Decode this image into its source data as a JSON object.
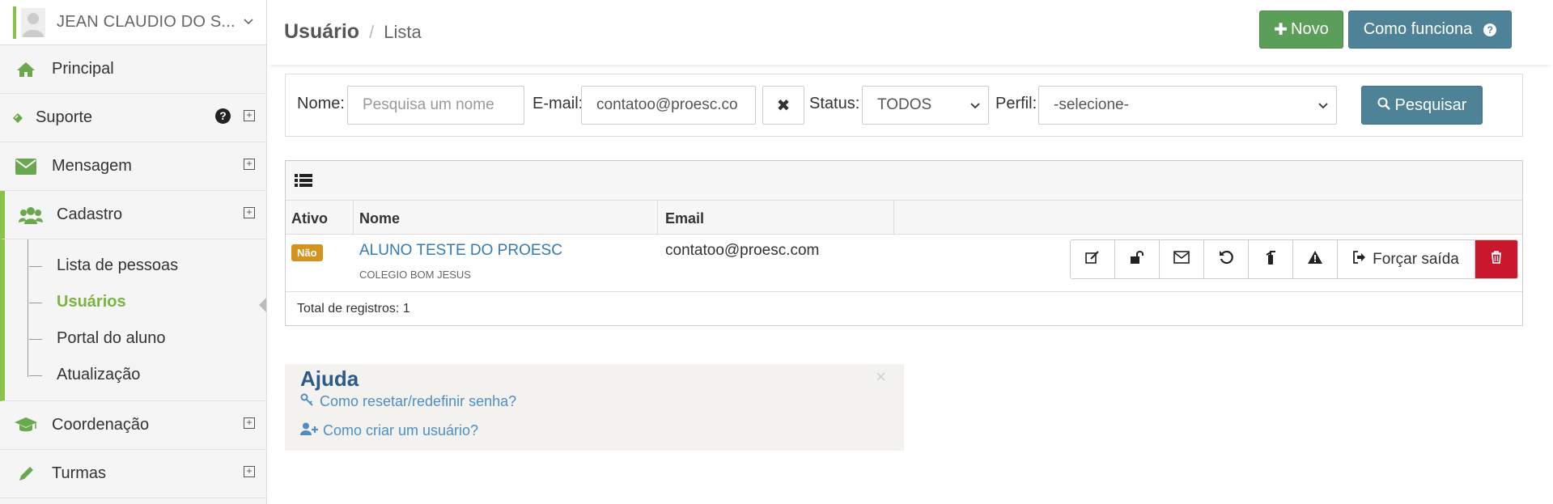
{
  "user": {
    "name": "JEAN CLAUDIO DO S..."
  },
  "sidebar": {
    "items": [
      {
        "label": "Principal"
      },
      {
        "label": "Suporte"
      },
      {
        "label": "Mensagem"
      },
      {
        "label": "Cadastro"
      },
      {
        "label": "Coordenação"
      },
      {
        "label": "Turmas"
      }
    ],
    "cadastro_sub": [
      {
        "label": "Lista de pessoas"
      },
      {
        "label": "Usuários"
      },
      {
        "label": "Portal do aluno"
      },
      {
        "label": "Atualização"
      }
    ]
  },
  "breadcrumb": {
    "section": "Usuário",
    "separator": "/",
    "page": "Lista"
  },
  "header": {
    "novo_label": "Novo",
    "como_label": "Como funciona"
  },
  "filter": {
    "nome_label": "Nome:",
    "nome_placeholder": "Pesquisa um nome",
    "email_label": "E-mail:",
    "email_value": "contatoo@proesc.co",
    "status_label": "Status:",
    "status_value": "TODOS",
    "perfil_label": "Perfil:",
    "perfil_value": "-selecione-",
    "search_label": "Pesquisar"
  },
  "table": {
    "columns": [
      "Ativo",
      "Nome",
      "Email"
    ],
    "rows": [
      {
        "ativo": "Não",
        "nome": "ALUNO TESTE DO PROESC",
        "escola": "COLEGIO BOM JESUS",
        "email": "contatoo@proesc.com"
      }
    ],
    "force_logout_label": "Forçar saída",
    "total_label": "Total de registros: 1"
  },
  "help": {
    "title": "Ajuda",
    "links": [
      "Como resetar/redefinir senha?",
      "Como criar um usuário?"
    ]
  },
  "colors": {
    "green": "#5a9e5a",
    "teal": "#4e8397",
    "accent": "#8bc34a",
    "danger": "#c9172d",
    "badge": "#d4921e"
  }
}
